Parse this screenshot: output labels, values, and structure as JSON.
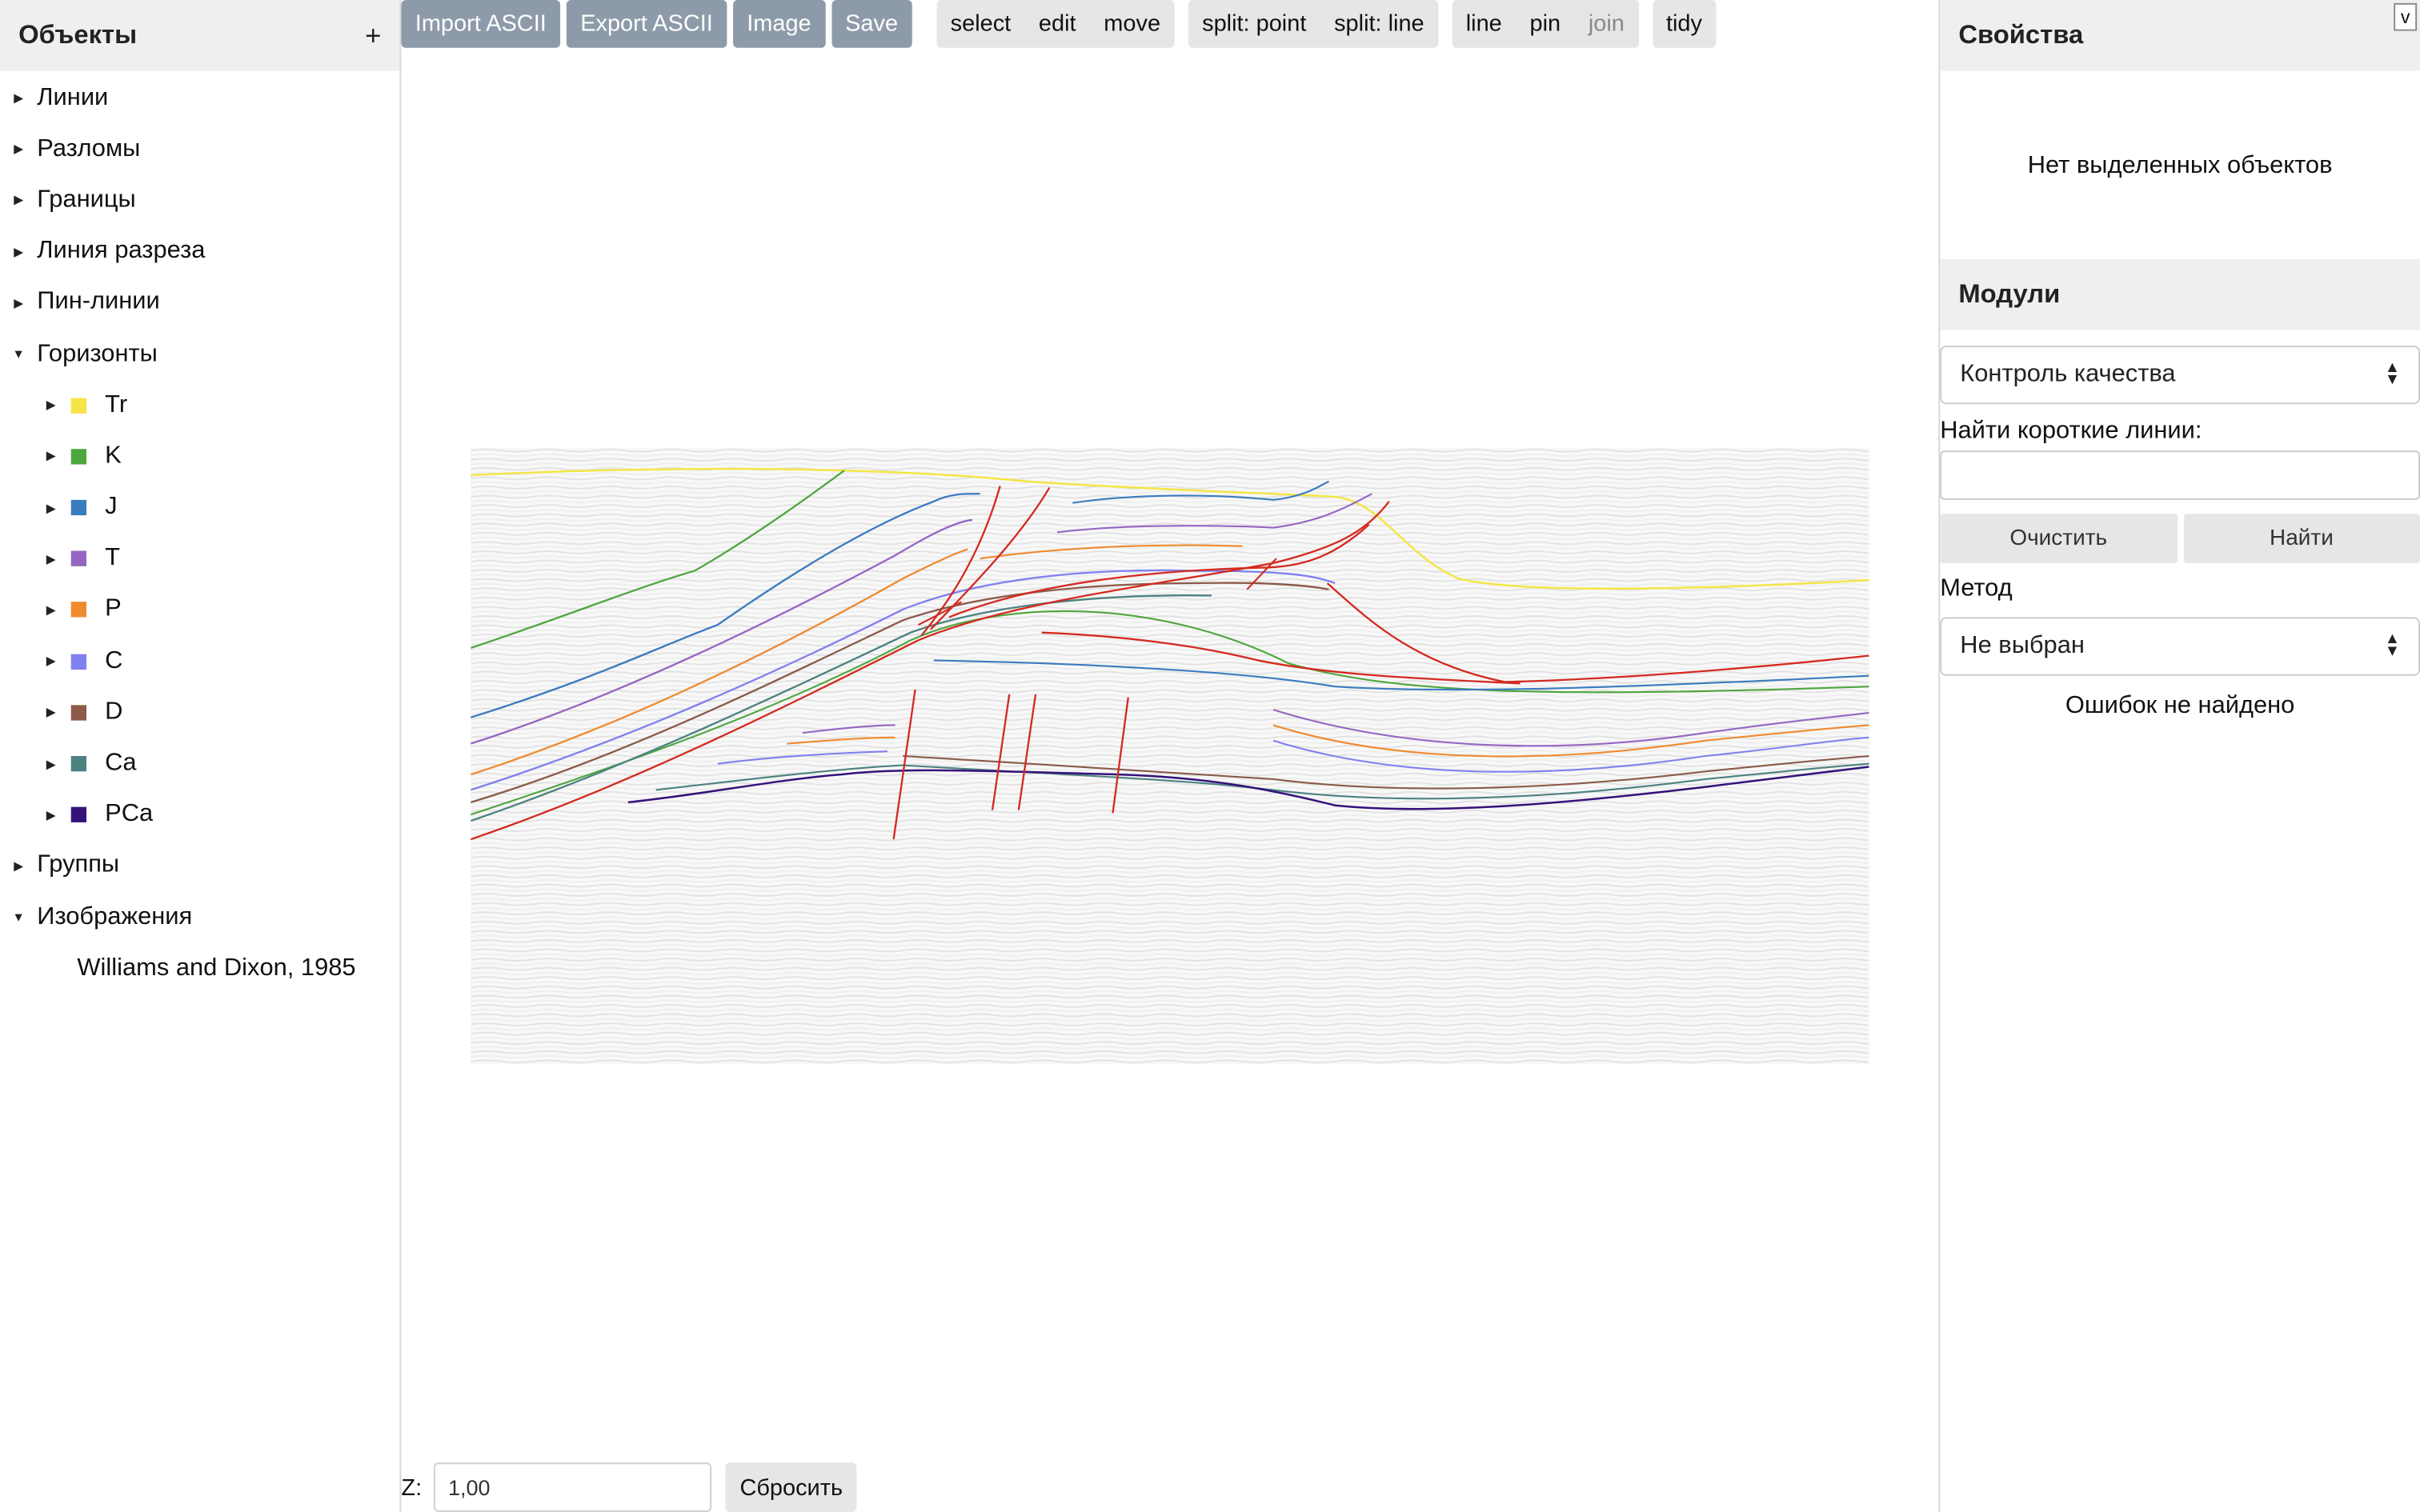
{
  "left_panel": {
    "title": "Объекты",
    "add_label": "+",
    "tree": [
      {
        "label": "Линии",
        "expanded": false
      },
      {
        "label": "Разломы",
        "expanded": false
      },
      {
        "label": "Границы",
        "expanded": false
      },
      {
        "label": "Линия разреза",
        "expanded": false
      },
      {
        "label": "Пин-линии",
        "expanded": false
      },
      {
        "label": "Горизонты",
        "expanded": true
      },
      {
        "label": "Группы",
        "expanded": false
      },
      {
        "label": "Изображения",
        "expanded": true
      }
    ],
    "horizons": [
      {
        "label": "Tr",
        "color": "#f5e546"
      },
      {
        "label": "K",
        "color": "#4ea63f"
      },
      {
        "label": "J",
        "color": "#3b7bbf"
      },
      {
        "label": "T",
        "color": "#9566c2"
      },
      {
        "label": "P",
        "color": "#ef8a2f"
      },
      {
        "label": "C",
        "color": "#8080f0"
      },
      {
        "label": "D",
        "color": "#8b5a4a"
      },
      {
        "label": "Ca",
        "color": "#4d8280"
      },
      {
        "label": "PCa",
        "color": "#35127a"
      }
    ],
    "images": [
      {
        "label": "Williams and Dixon, 1985"
      }
    ]
  },
  "toolbar": {
    "file_buttons": [
      "Import ASCII",
      "Export ASCII",
      "Image",
      "Save"
    ],
    "mode_group": [
      "select",
      "edit",
      "move"
    ],
    "split_group": [
      "split: point",
      "split: line"
    ],
    "draw_group": [
      "line",
      "pin",
      "join"
    ],
    "tidy_label": "tidy"
  },
  "zoom": {
    "label": "Z:",
    "value": "1,00",
    "reset_label": "Сбросить"
  },
  "right_panel": {
    "collapse_label": "v",
    "properties_title": "Свойства",
    "no_selection_text": "Нет выделенных объектов",
    "modules_title": "Модули",
    "module_select": "Контроль качества",
    "find_short_lines_label": "Найти короткие линии:",
    "clear_label": "Очистить",
    "find_label": "Найти",
    "method_label": "Метод",
    "method_select": "Не выбран",
    "result_text": "Ошибок не найдено"
  },
  "colors": {
    "fault": "#d42a20",
    "toolbar_dark": "#8d9aa9",
    "panel_header_bg": "#efefef"
  }
}
